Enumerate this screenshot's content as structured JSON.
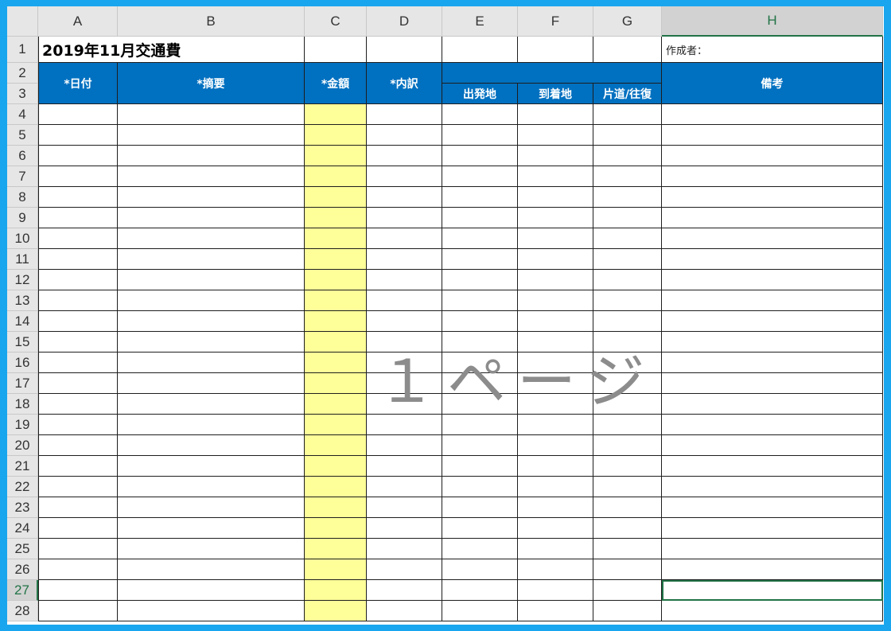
{
  "columns": [
    "A",
    "B",
    "C",
    "D",
    "E",
    "F",
    "G",
    "H"
  ],
  "selected_column": "H",
  "selected_row": "27",
  "row_numbers": [
    "1",
    "2",
    "3",
    "4",
    "5",
    "6",
    "7",
    "8",
    "9",
    "10",
    "11",
    "12",
    "13",
    "14",
    "15",
    "16",
    "17",
    "18",
    "19",
    "20",
    "21",
    "22",
    "23",
    "24",
    "25",
    "26",
    "27",
    "28"
  ],
  "sheet": {
    "title": "2019年11月交通費",
    "author_label": "作成者：",
    "headers": {
      "date": "*日付",
      "summary": "*摘要",
      "amount": "*金額",
      "breakdown": "*内訳",
      "departure": "出発地",
      "arrival": "到着地",
      "trip_type": "片道/往復",
      "remarks": "備考"
    },
    "page_watermark": "１ページ"
  },
  "colors": {
    "header_fill": "#0070c0",
    "amount_column_fill": "#ffff99",
    "selection": "#217346",
    "frame": "#1aa6ee"
  }
}
